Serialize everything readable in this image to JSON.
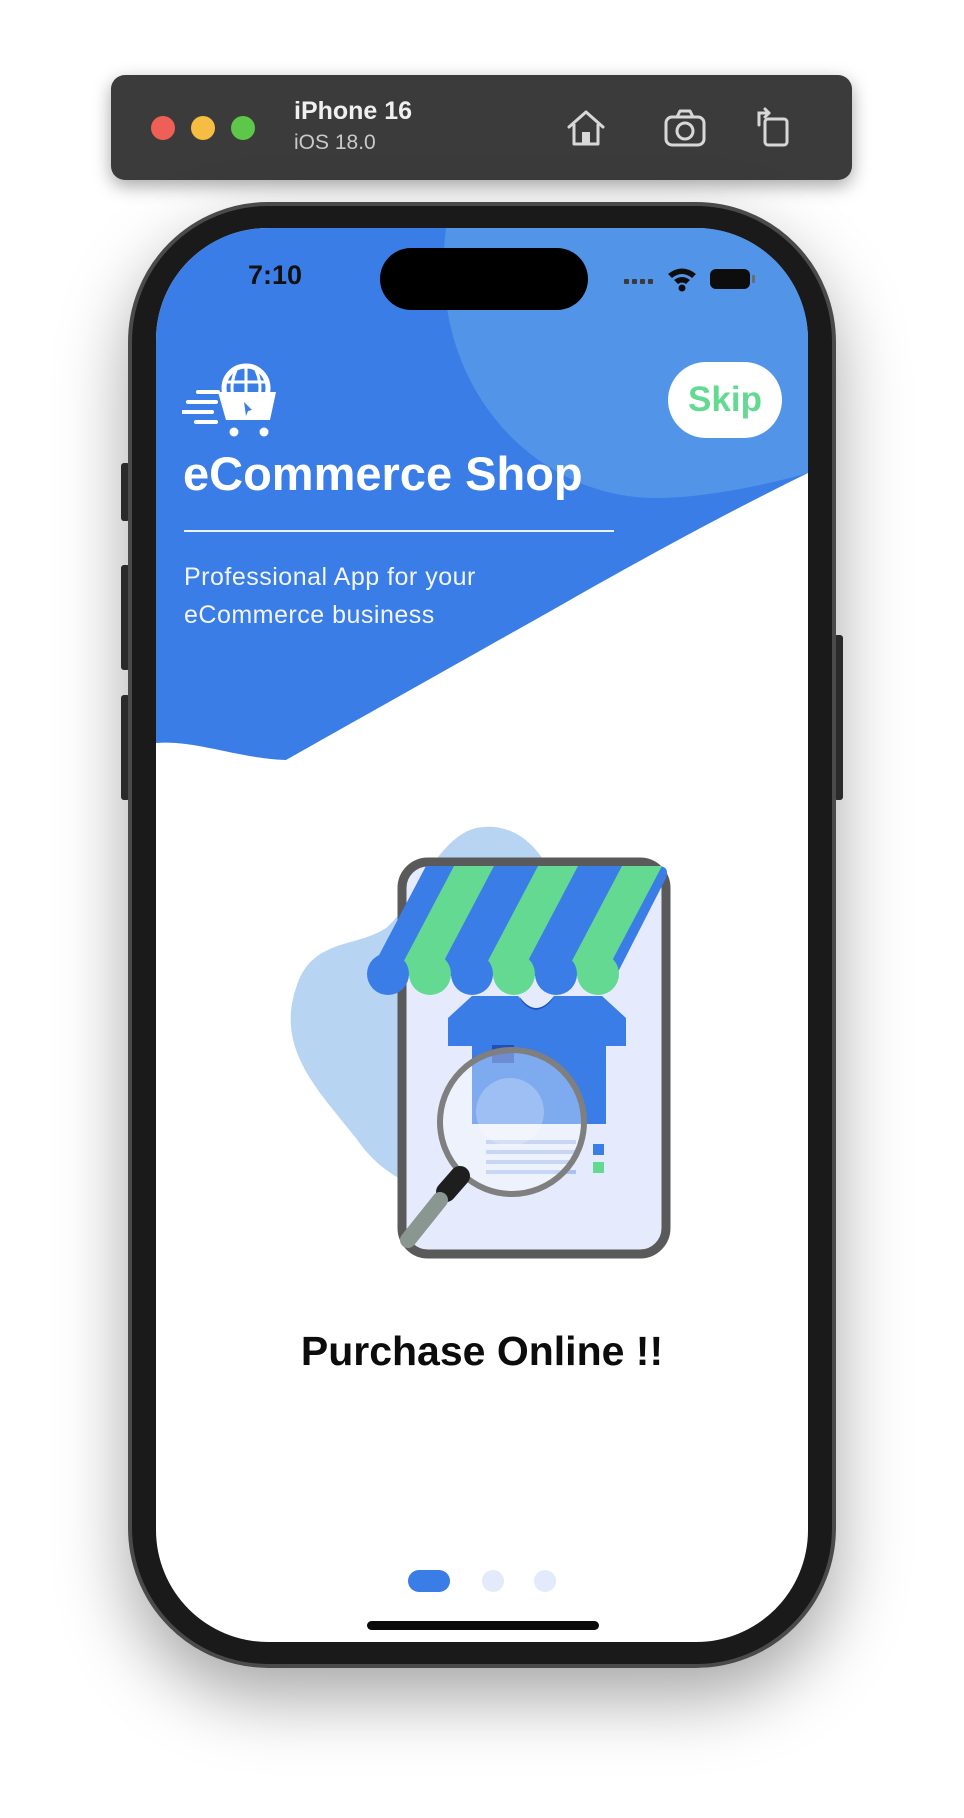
{
  "simulator": {
    "device_name": "iPhone 16",
    "os_version": "iOS 18.0",
    "tools": [
      "home-icon",
      "screenshot-icon",
      "rotate-icon"
    ]
  },
  "status_bar": {
    "time": "7:10"
  },
  "header": {
    "skip_label": "Skip",
    "app_title": "eCommerce Shop",
    "tagline": "Professional App for your eCommerce business"
  },
  "onboarding": {
    "headline": "Purchase Online !!",
    "page_count": 3,
    "active_page": 1
  },
  "colors": {
    "primary_blue": "#3a7de6",
    "light_blue": "#5295e8",
    "accent_green": "#63d992",
    "inactive_dot": "#e2eafb"
  }
}
